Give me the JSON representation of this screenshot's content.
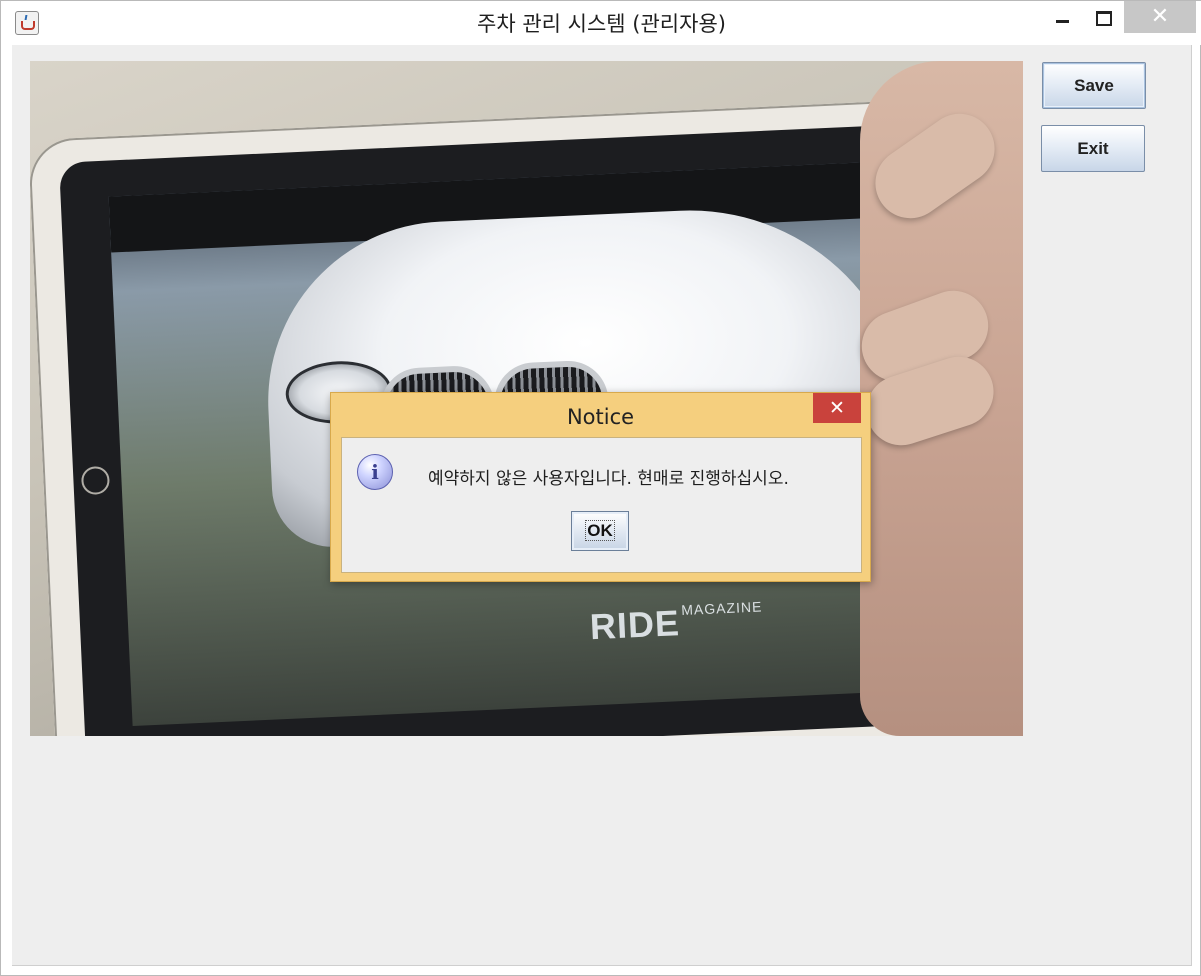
{
  "window": {
    "title": "주차 관리 시스템 (관리자용)",
    "controls": {
      "close_glyph": "✕"
    }
  },
  "toolbar": {
    "save_label": "Save",
    "exit_label": "Exit"
  },
  "camera_view": {
    "overlay_text": "RIDE",
    "overlay_small": "MAGAZINE"
  },
  "dialog": {
    "title": "Notice",
    "message": "예약하지 않은 사용자입니다. 현매로 진행하십시오.",
    "icon_glyph": "i",
    "ok_label": "OK",
    "close_glyph": "✕"
  },
  "colors": {
    "dialog_frame": "#f5cf7e",
    "dialog_close": "#c9423c",
    "content_bg": "#eeeeee"
  }
}
